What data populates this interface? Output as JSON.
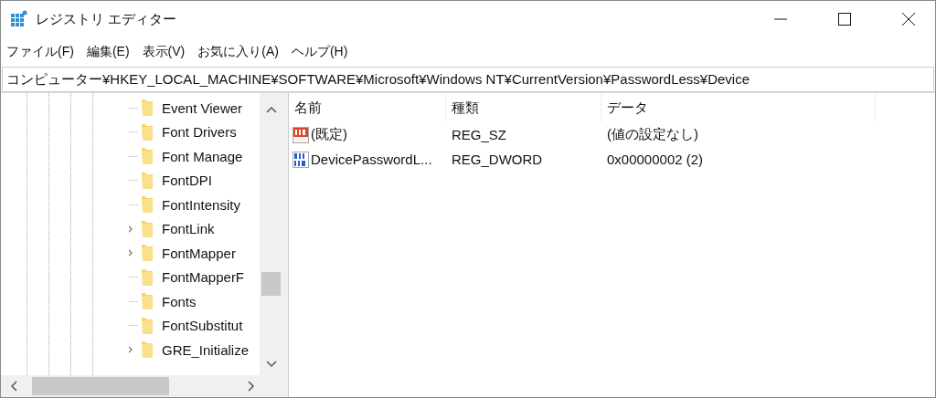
{
  "window": {
    "title": "レジストリ エディター"
  },
  "menu": [
    "ファイル(F)",
    "編集(E)",
    "表示(V)",
    "お気に入り(A)",
    "ヘルプ(H)"
  ],
  "address": "コンピューター¥HKEY_LOCAL_MACHINE¥SOFTWARE¥Microsoft¥Windows NT¥CurrentVersion¥PasswordLess¥Device",
  "tree": [
    {
      "label": "Event Viewer",
      "expandable": false
    },
    {
      "label": "Font Drivers",
      "expandable": false
    },
    {
      "label": "Font Manage",
      "expandable": false
    },
    {
      "label": "FontDPI",
      "expandable": false
    },
    {
      "label": "FontIntensity",
      "expandable": false
    },
    {
      "label": "FontLink",
      "expandable": true
    },
    {
      "label": "FontMapper",
      "expandable": true
    },
    {
      "label": "FontMapperF",
      "expandable": false
    },
    {
      "label": "Fonts",
      "expandable": false
    },
    {
      "label": "FontSubstitut",
      "expandable": false
    },
    {
      "label": "GRE_Initialize",
      "expandable": true
    }
  ],
  "table": {
    "columns": [
      "名前",
      "種類",
      "データ"
    ],
    "rows": [
      {
        "kind": "string",
        "name": "(既定)",
        "type": "REG_SZ",
        "data": "(値の設定なし)"
      },
      {
        "kind": "dword",
        "name": "DevicePasswordL...",
        "type": "REG_DWORD",
        "data": "0x00000002 (2)"
      }
    ]
  }
}
